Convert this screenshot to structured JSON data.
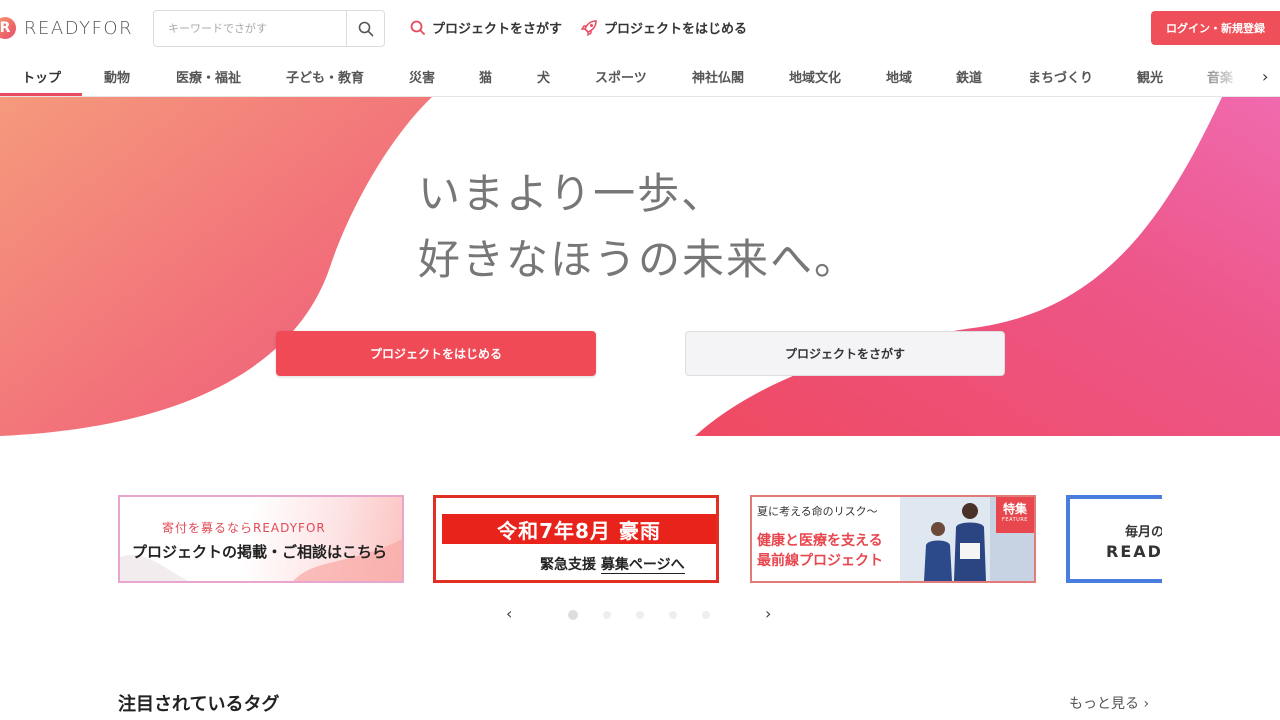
{
  "header": {
    "logo_mark": "R",
    "logo_text": "READYFOR",
    "search_placeholder": "キーワードでさがす",
    "nav_find": "プロジェクトをさがす",
    "nav_start": "プロジェクトをはじめる",
    "login_label": "ログイン・新規登録"
  },
  "categories": [
    "トップ",
    "動物",
    "医療・福祉",
    "子ども・教育",
    "災害",
    "猫",
    "犬",
    "スポーツ",
    "神社仏閣",
    "地域文化",
    "地域",
    "鉄道",
    "まちづくり",
    "観光",
    "音楽"
  ],
  "active_category": "トップ",
  "hero": {
    "line1": "いまより一歩、",
    "line2": "好きなほうの未来へ。",
    "primary_button": "プロジェクトをはじめる",
    "secondary_button": "プロジェクトをさがす"
  },
  "banners": {
    "b1_line1": "寄付を募るならREADYFOR",
    "b1_line2": "プロジェクトの掲載・ご相談はこちら",
    "b2_top": "令和7年8月 豪雨",
    "b2_bottom_a": "緊急支援",
    "b2_bottom_b": "募集ページへ",
    "b3_line1": "夏に考える命のリスク〜",
    "b3_line2": "健康と医療を支える",
    "b3_line3": "最前線プロジェクト",
    "b3_tag": "特集",
    "b3_tag_sub": "FEATURE",
    "b4_line1": "毎月の",
    "b4_line2": "READ"
  },
  "carousel": {
    "dots": 5,
    "active_index": 0
  },
  "section": {
    "title": "注目されているタグ",
    "more": "もっと見る"
  },
  "colors": {
    "brand": "#ef4f59",
    "text": "#333333",
    "hero_text": "#777777"
  }
}
